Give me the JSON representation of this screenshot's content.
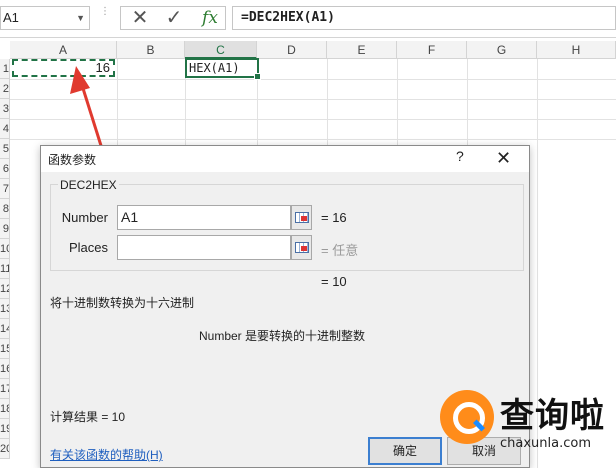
{
  "formula_bar": {
    "name_box": "A1",
    "fx_label": "fx",
    "formula": "=DEC2HEX(A1)"
  },
  "grid": {
    "columns": [
      "A",
      "B",
      "C",
      "D",
      "E",
      "F",
      "G",
      "H"
    ],
    "active_column": "C",
    "rows": [
      "1",
      "2",
      "3",
      "4",
      "5",
      "6",
      "7",
      "8",
      "9",
      "10",
      "11",
      "12",
      "13",
      "14",
      "15",
      "16",
      "17",
      "18",
      "19",
      "20"
    ],
    "cell_a1": "16",
    "cell_c1": "HEX(A1)"
  },
  "dialog": {
    "title": "函数参数",
    "help": "?",
    "close": "✕",
    "function_name": "DEC2HEX",
    "args": [
      {
        "label": "Number",
        "value": "A1",
        "result": "= 16"
      },
      {
        "label": "Places",
        "value": "",
        "result": "= 任意"
      }
    ],
    "result_line": "= 10",
    "description": "将十进制数转换为十六进制",
    "arg_description": "Number  是要转换的十进制整数",
    "calc_result": "计算结果 =  10",
    "help_link": "有关该函数的帮助(H)",
    "ok_label": "确定",
    "cancel_label": "取消"
  },
  "watermark": {
    "name": "查询啦",
    "url": "chaxunla.com"
  },
  "colors": {
    "excel_green": "#217346",
    "annotation_red": "#e03a2f",
    "watermark_orange": "#ff8c1a"
  }
}
